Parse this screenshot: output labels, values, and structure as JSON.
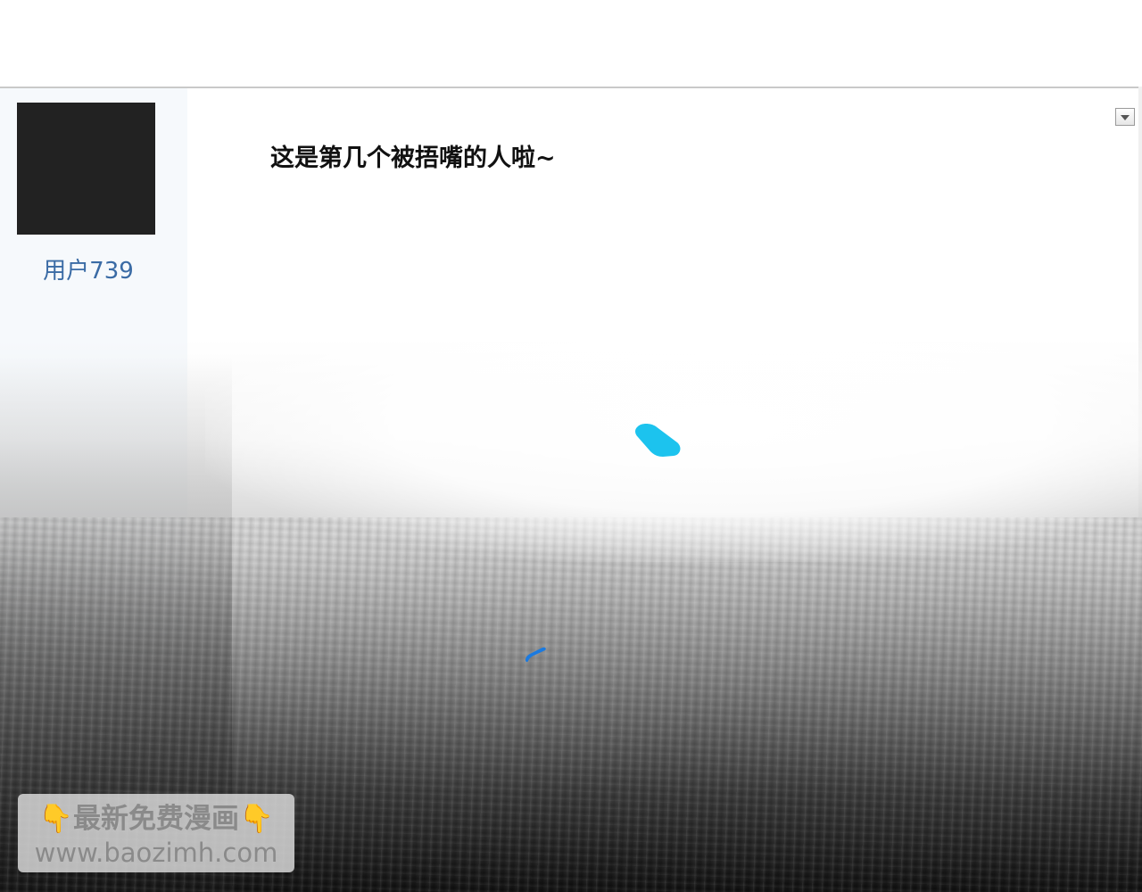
{
  "post": {
    "username": "用户739",
    "message": "这是第几个被捂嘴的人啦~"
  },
  "watermark": {
    "line1": "👇最新免费漫画👇",
    "line2": "www.baozimh.com"
  },
  "icons": {
    "dropdown": "chevron-down-icon",
    "avatar": "avatar-placeholder"
  },
  "colors": {
    "username": "#3a6ba5",
    "sidebar_bg": "#f6f9fc",
    "mark_cyan": "#1cc3ee",
    "mark_blue": "#1a7ae0"
  }
}
